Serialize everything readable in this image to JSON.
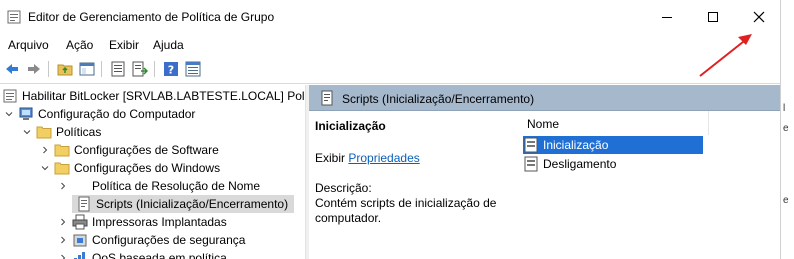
{
  "window": {
    "title": "Editor de Gerenciamento de Política de Grupo",
    "controls": {
      "minimize": "minimize-icon",
      "maximize": "maximize-icon",
      "close": "close-icon"
    }
  },
  "menu": {
    "items": [
      "Arquivo",
      "Ação",
      "Exibir",
      "Ajuda"
    ]
  },
  "tree": {
    "root": "Habilitar BitLocker [SRVLAB.LABTESTE.LOCAL] Polític",
    "items": [
      {
        "label": "Configuração do Computador"
      },
      {
        "label": "Políticas"
      },
      {
        "label": "Configurações de Software"
      },
      {
        "label": "Configurações do Windows"
      },
      {
        "label": "Política de Resolução de Nome"
      },
      {
        "label": "Scripts (Inicialização/Encerramento)"
      },
      {
        "label": "Impressoras Implantadas"
      },
      {
        "label": "Configurações de segurança"
      },
      {
        "label": "QoS baseada em política"
      }
    ]
  },
  "detail": {
    "header": "Scripts (Inicialização/Encerramento)",
    "section_title": "Inicialização",
    "show_label": "Exibir",
    "properties_link": "Propriedades",
    "description_label": "Descrição:",
    "description_text_1": "Contém scripts de inicialização de",
    "description_text_2": "computador.",
    "column_header": "Nome",
    "list": [
      {
        "label": "Inicialização"
      },
      {
        "label": "Desligamento"
      }
    ]
  },
  "right_strip": {
    "chars": [
      "l",
      "e",
      "e"
    ]
  },
  "colors": {
    "accent": "#1f6fd4",
    "header_band": "#a6b8cc",
    "link": "#0b60b8",
    "annotation_arrow": "#e02020"
  }
}
